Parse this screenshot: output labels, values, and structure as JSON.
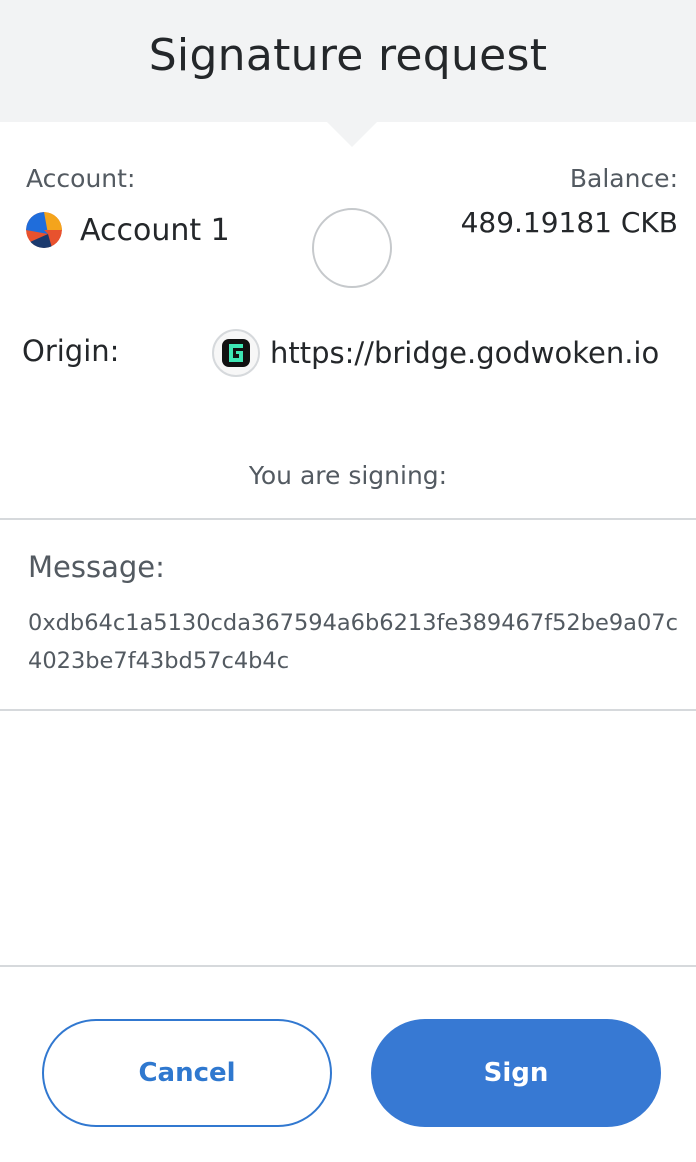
{
  "header": {
    "title": "Signature request"
  },
  "account": {
    "label": "Account:",
    "name": "Account 1",
    "avatar_icon": "jazzicon-avatar",
    "avatar_colors": [
      "#1f6ddb",
      "#e8522e",
      "#f4a41c",
      "#1b3a6e"
    ]
  },
  "balance": {
    "label": "Balance:",
    "value": "489.19181 CKB"
  },
  "origin": {
    "label": "Origin:",
    "url": "https://bridge.godwoken.io",
    "icon": "godwoken-site-icon",
    "icon_colors": [
      "#111111",
      "#3ee6b4"
    ]
  },
  "signing": {
    "label": "You are signing:"
  },
  "message": {
    "label": "Message:",
    "value": "0xdb64c1a5130cda367594a6b6213fe389467f52be9a07c4023be7f43bd57c4b4c"
  },
  "actions": {
    "cancel_label": "Cancel",
    "sign_label": "Sign"
  },
  "colors": {
    "primary": "#3779d3",
    "header_bg": "#f2f3f4",
    "divider": "#d6d9dc"
  }
}
